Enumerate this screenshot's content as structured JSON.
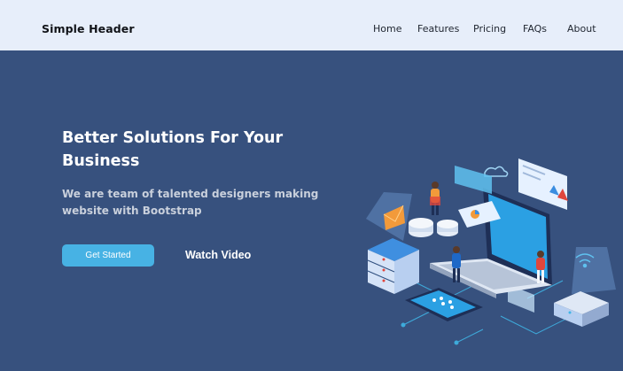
{
  "header": {
    "brand": "Simple Header",
    "nav": [
      {
        "label": "Home"
      },
      {
        "label": "Features"
      },
      {
        "label": "Pricing"
      },
      {
        "label": "FAQs"
      },
      {
        "label": "About"
      }
    ]
  },
  "hero": {
    "title": "Better Solutions For Your Business",
    "subtitle": "We are team of talented designers making website with Bootstrap",
    "primary_button": "Get Started",
    "secondary_link": "Watch Video",
    "illustration": "isometric-server-laptop-illustration"
  },
  "colors": {
    "header_bg": "#e7eefa",
    "hero_bg": "#37517e",
    "accent": "#47b2e4"
  }
}
